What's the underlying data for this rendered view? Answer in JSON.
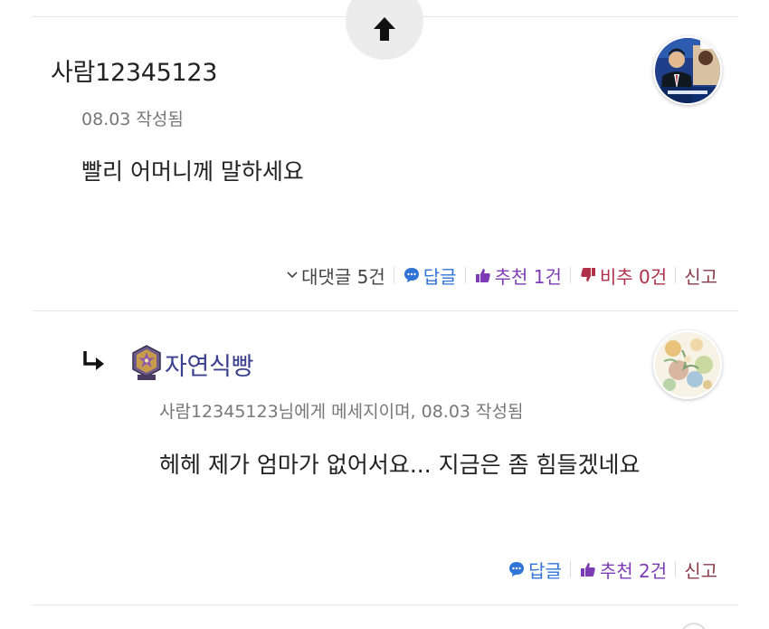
{
  "comments": [
    {
      "author": "사람12345123",
      "meta": "08.03 작성됨",
      "body": "빨리 어머니께 말하세요",
      "avatar_icon": "news-anchor-avatar",
      "actions": {
        "replies": "대댓글 5건",
        "reply": "답글",
        "recommend": "추천 1건",
        "dislike": "비추 0건",
        "report": "신고"
      }
    },
    {
      "author": "자연식빵",
      "badge_icon": "purple-flower-rank-badge",
      "meta": "사람12345123님에게 메세지이며, 08.03 작성됨",
      "body": "헤헤 제가 엄마가 없어서요... 지금은 좀 힘들겠네요",
      "avatar_icon": "floral-illustration-avatar",
      "actions": {
        "reply": "답글",
        "recommend": "추천 2건",
        "report": "신고"
      }
    }
  ],
  "colors": {
    "reply": "#2f74d6",
    "recommend": "#7d3cb5",
    "dislike": "#b0304a",
    "author_highlight": "#3b3f8f"
  }
}
